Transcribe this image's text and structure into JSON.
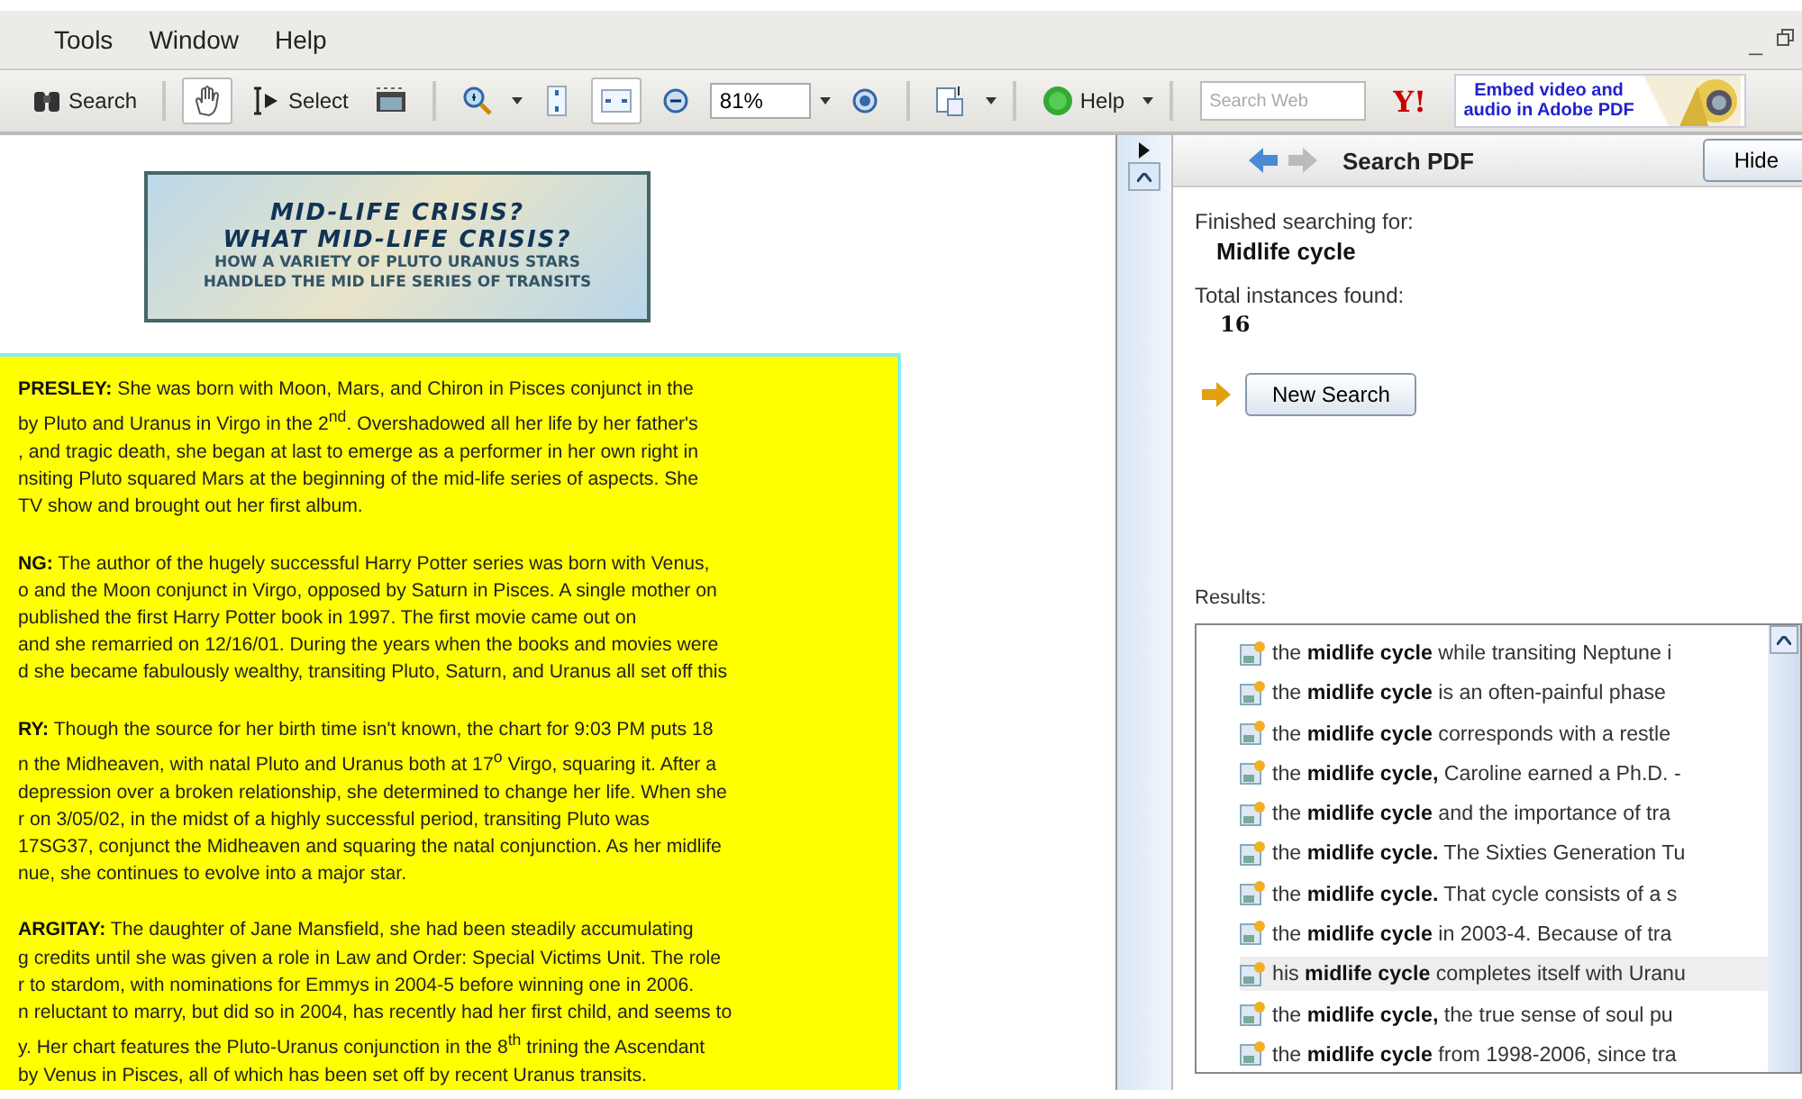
{
  "menu": [
    "Tools",
    "Window",
    "Help"
  ],
  "window_controls": {
    "minimize": "_"
  },
  "toolbar": [
    {
      "kind": "binoculars",
      "label": "Search",
      "pressed": false
    },
    {
      "kind": "sep"
    },
    {
      "kind": "hand",
      "pressed": true
    },
    {
      "kind": "select",
      "label": "Select",
      "pressed": false
    },
    {
      "kind": "camera",
      "pressed": false
    },
    {
      "kind": "sep"
    },
    {
      "kind": "zoom",
      "pressed": false,
      "dropdown": true
    },
    {
      "kind": "fitpage",
      "pressed": false
    },
    {
      "kind": "fitwidth",
      "pressed": true
    },
    {
      "kind": "minus",
      "pressed": false
    },
    {
      "kind": "field",
      "value": "81%",
      "dropdown": true
    },
    {
      "kind": "plus",
      "pressed": false
    },
    {
      "kind": "sep"
    },
    {
      "kind": "pages",
      "pressed": false,
      "dropdown": true
    },
    {
      "kind": "sep"
    },
    {
      "kind": "help",
      "label": "Help",
      "pressed": false,
      "dropdown": true
    },
    {
      "kind": "sep"
    },
    {
      "kind": "search",
      "placeholder": "Search Web"
    },
    {
      "kind": "logo",
      "label": "Y!"
    },
    {
      "kind": "ad",
      "label": "Embed video and audio in Adobe PDF"
    }
  ],
  "document": {
    "banner": [
      "MID-LIFE CRISIS?",
      "WHAT MID-LIFE CRISIS?",
      "HOW A VARIETY OF PLUTO URANUS STARS",
      "HANDLED THE MID LIFE SERIES OF TRANSITS"
    ],
    "paragraphs": [
      [
        "**PRESLEY:**  She was born with Moon, Mars, and Chiron in Pisces conjunct in the",
        "by Pluto and Uranus in Virgo in the 2$^{nd}$. Overshadowed all her life by her father's",
        ", and tragic death, she began at last to emerge as a performer in her own right in",
        "nsiting Pluto squared Mars at the beginning of the mid-life series of aspects. She",
        "TV show and brought out her first album."
      ],
      [
        "**NG:**  The author of the hugely successful Harry Potter series was born with Venus,",
        "o and the Moon conjunct in Virgo, opposed by Saturn in Pisces. A single mother on",
        "published the first Harry Potter book in 1997. The first movie came out on",
        "and she remarried on 12/16/01. During the years when the books and movies were",
        "d she became fabulously wealthy, transiting Pluto, Saturn, and Uranus all set off this"
      ],
      [
        "**RY:**  Though the source for her birth time isn't known, the chart for 9:03 PM puts 18",
        "n the Midheaven, with natal Pluto and Uranus both at 17$^{o}$  Virgo, squaring it.  After a",
        "depression over a broken relationship, she determined to change her life. When she",
        "r on 3/05/02, in the midst of a highly successful period, transiting Pluto was",
        "17SG37, conjunct the Midheaven and squaring the natal conjunction. As her midlife",
        "nue, she continues to evolve into a major star."
      ],
      [
        "**ARGITAY:** The daughter of Jane Mansfield, she had been steadily accumulating",
        "g credits until she was given a role in Law and Order: Special Victims Unit. The role",
        "r to stardom, with nominations for Emmys in 2004-5 before winning one in 2006.",
        "n reluctant to marry, but did so in 2004, has recently had her first child, and seems to",
        "y. Her chart features the Pluto-Uranus conjunction in the 8$^{th}$ trining the Ascendant",
        "by Venus in Pisces, all of which has been set off by recent Uranus transits."
      ]
    ]
  },
  "panel": {
    "title": "Search PDF",
    "hide": "Hide",
    "finished_label": "Finished searching for:",
    "query": "Midlife cycle",
    "total_label": "Total instances found:",
    "total": "16",
    "new_search": "New Search",
    "results_label": "Results:",
    "results": [
      {
        "text": "the **midlife cycle** while transiting Neptune i",
        "selected": false
      },
      {
        "text": "the **midlife cycle** is an often-painful phase",
        "selected": false
      },
      {
        "text": "the **midlife cycle** corresponds with a restle",
        "selected": false
      },
      {
        "text": "the **midlife cycle,** Caroline earned a Ph.D. -",
        "selected": false
      },
      {
        "text": "the **midlife cycle** and the importance of tra",
        "selected": false
      },
      {
        "text": "the **midlife cycle.** The Sixties Generation Tu",
        "selected": false
      },
      {
        "text": "the **midlife cycle.** That cycle consists of a s",
        "selected": false
      },
      {
        "text": "the **midlife cycle** in 2003-4. Because of tra",
        "selected": false
      },
      {
        "text": "his **midlife cycle** completes itself with Uranu",
        "selected": true
      },
      {
        "text": "the **midlife cycle,** the true sense of soul pu",
        "selected": false
      },
      {
        "text": "the **midlife cycle** from 1998-2006, since tra",
        "selected": false
      }
    ]
  }
}
